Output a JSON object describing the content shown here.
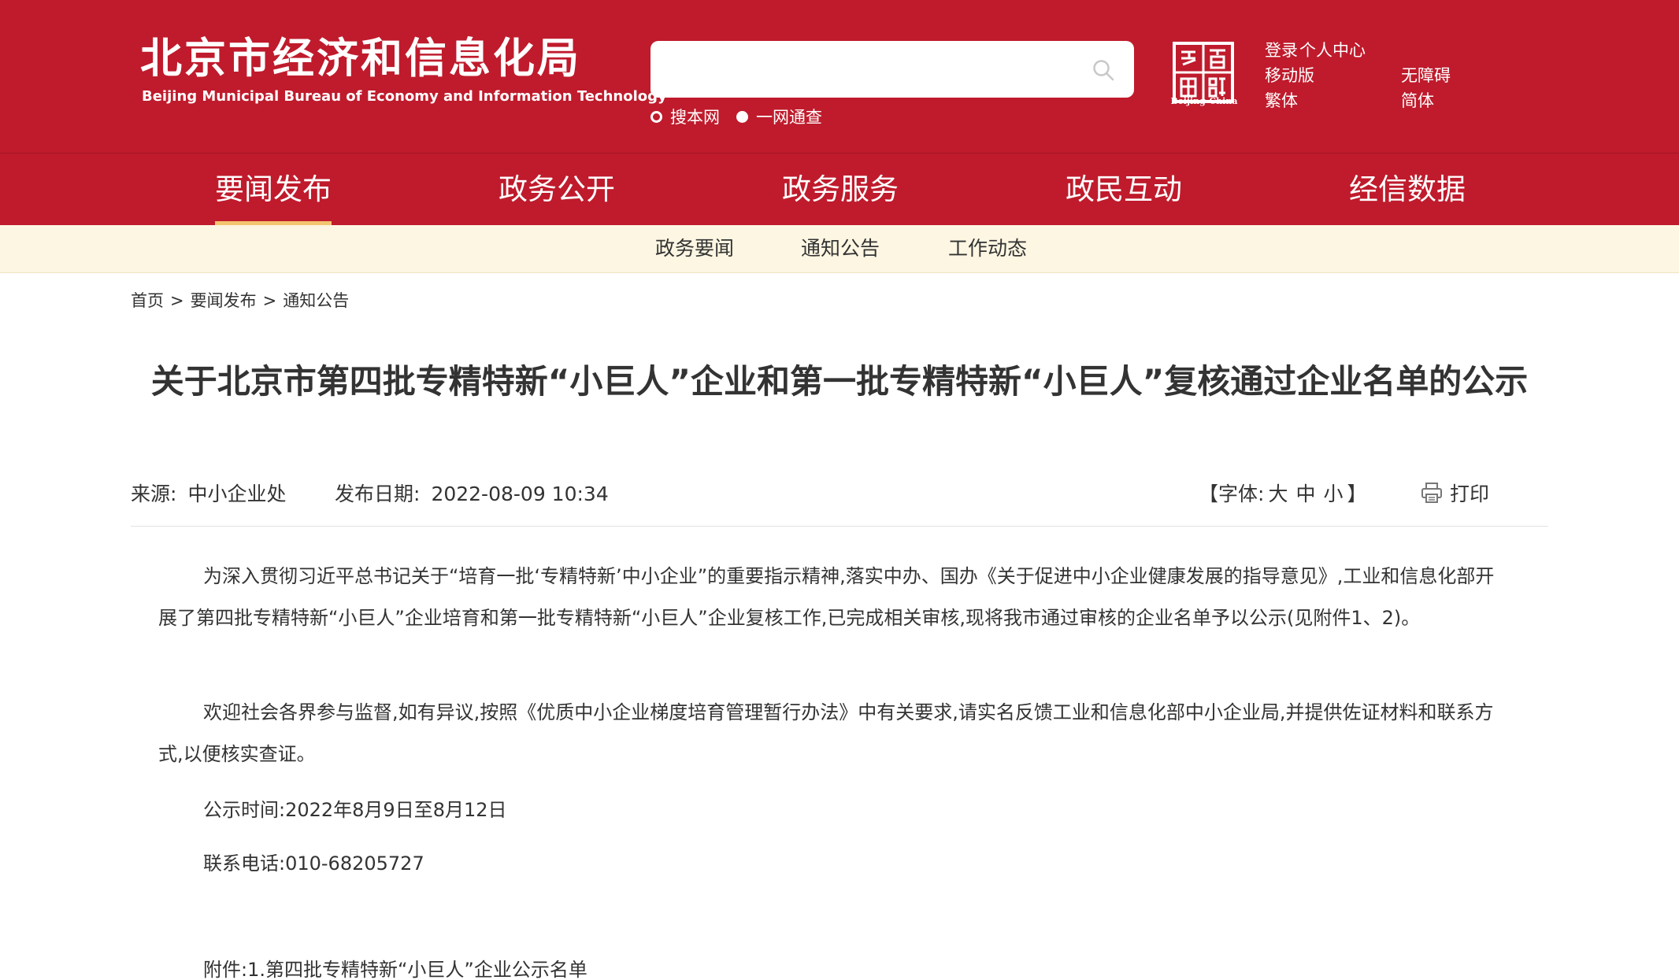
{
  "header": {
    "title_cn": "北京市经济和信息化局",
    "title_en": "Beijing Municipal Bureau of Economy and Information Technology",
    "search": {
      "placeholder": "",
      "options": [
        "搜本网",
        "一网通查"
      ],
      "selected": "一网通查"
    },
    "capital_logo_text": "Beijing-China",
    "links": {
      "login": "登录",
      "personal_center": "个人中心",
      "mobile": "移动版",
      "accessibility": "无障碍",
      "traditional": "繁体",
      "simplified": "简体"
    }
  },
  "nav": {
    "items": [
      "要闻发布",
      "政务公开",
      "政务服务",
      "政民互动",
      "经信数据"
    ],
    "active": "要闻发布"
  },
  "subnav": {
    "items": [
      "政务要闻",
      "通知公告",
      "工作动态"
    ]
  },
  "breadcrumb": {
    "items": [
      "首页",
      "要闻发布",
      "通知公告"
    ],
    "separator": ">"
  },
  "article": {
    "title": "关于北京市第四批专精特新“小巨人”企业和第一批专精特新“小巨人”复核通过企业名单的公示",
    "source_label": "来源:",
    "source": "中小企业处",
    "date_label": "发布日期:",
    "date": "2022-08-09 10:34",
    "font_label_open": "【字体:",
    "font_sizes": [
      "大",
      "中",
      "小"
    ],
    "font_label_close": "】",
    "print_label": "打印",
    "paragraphs": [
      "为深入贯彻习近平总书记关于“培育一批‘专精特新’中小企业”的重要指示精神,落实中办、国办《关于促进中小企业健康发展的指导意见》,工业和信息化部开展了第四批专精特新“小巨人”企业培育和第一批专精特新“小巨人”企业复核工作,已完成相关审核,现将我市通过审核的企业名单予以公示(见附件1、2)。",
      "欢迎社会各界参与监督,如有异议,按照《优质中小企业梯度培育管理暂行办法》中有关要求,请实名反馈工业和信息化部中小企业局,并提供佐证材料和联系方式,以便核实查证。"
    ],
    "publicity_time": "公示时间:2022年8月9日至8月12日",
    "phone": "联系电话:010-68205727",
    "attachment": "附件:1.第四批专精特新“小巨人”企业公示名单"
  },
  "colors": {
    "brand_red": "#bf1b2c",
    "nav_active_underline": "#f4c56f",
    "subnav_bg": "#fcf6e2"
  },
  "icons": {
    "search": "search-icon",
    "print": "printer-icon",
    "capital_logo": "capital-window-logo"
  }
}
